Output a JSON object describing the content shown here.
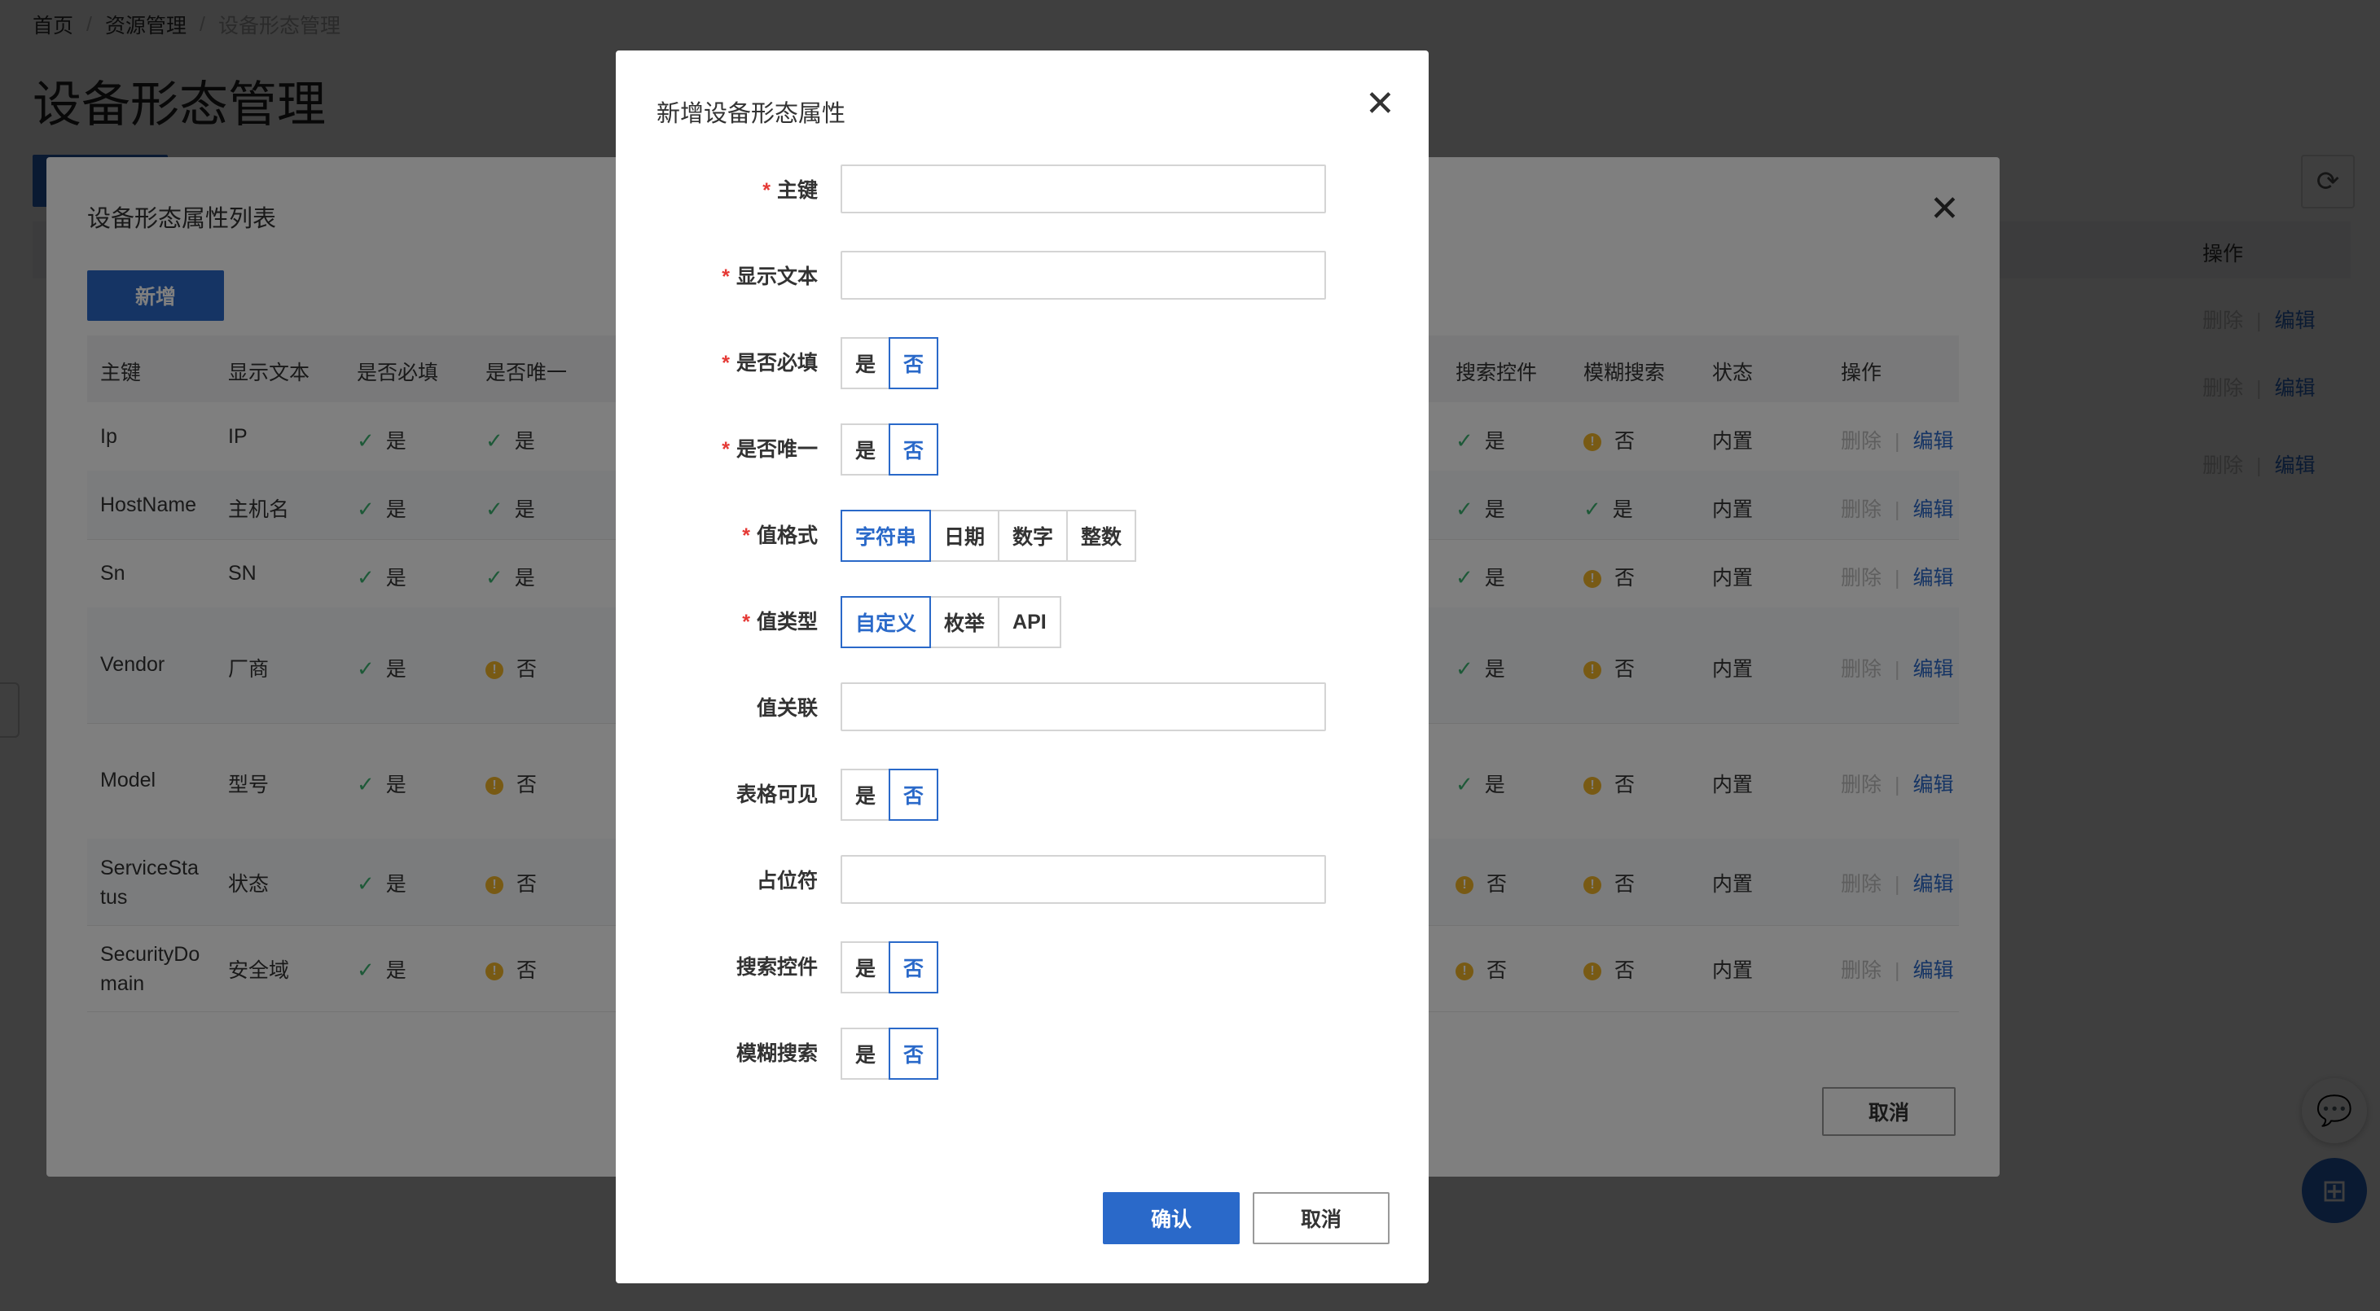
{
  "breadcrumb": [
    "首页",
    "资源管理",
    "设备形态管理"
  ],
  "page": {
    "title": "设备形态管理",
    "table_op_header": "操作",
    "row_ops": [
      {
        "delete": "删除",
        "edit": "编辑"
      },
      {
        "delete": "删除",
        "edit": "编辑"
      },
      {
        "delete": "删除",
        "edit": "编辑"
      }
    ]
  },
  "list_modal": {
    "title": "设备形态属性列表",
    "add_label": "新增",
    "cancel_label": "取消",
    "columns": [
      "主键",
      "显示文本",
      "是否必填",
      "是否唯一",
      "搜索控件",
      "模糊搜索",
      "状态",
      "操作"
    ],
    "rows": [
      {
        "key": "Ip",
        "text": "IP",
        "required": "是",
        "unique": "是",
        "search": "是",
        "fuzzy": "否",
        "status": "内置",
        "del": "删除",
        "edit": "编辑"
      },
      {
        "key": "HostName",
        "text": "主机名",
        "required": "是",
        "unique": "是",
        "search": "是",
        "fuzzy": "是",
        "status": "内置",
        "del": "删除",
        "edit": "编辑"
      },
      {
        "key": "Sn",
        "text": "SN",
        "required": "是",
        "unique": "是",
        "search": "是",
        "fuzzy": "否",
        "status": "内置",
        "del": "删除",
        "edit": "编辑"
      },
      {
        "key": "Vendor",
        "text": "厂商",
        "required": "是",
        "unique": "否",
        "search": "是",
        "fuzzy": "否",
        "status": "内置",
        "del": "删除",
        "edit": "编辑"
      },
      {
        "key": "Model",
        "text": "型号",
        "required": "是",
        "unique": "否",
        "search": "是",
        "fuzzy": "否",
        "status": "内置",
        "del": "删除",
        "edit": "编辑"
      },
      {
        "key1": "ServiceSta",
        "key2": "tus",
        "text": "状态",
        "required": "是",
        "unique": "否",
        "search": "否",
        "fuzzy": "否",
        "status": "内置",
        "del": "删除",
        "edit": "编辑"
      },
      {
        "key1": "SecurityDo",
        "key2": "main",
        "text": "安全域",
        "required": "是",
        "unique": "否",
        "search": "否",
        "fuzzy": "否",
        "status": "内置",
        "del": "删除",
        "edit": "编辑"
      }
    ]
  },
  "form_modal": {
    "title": "新增设备形态属性",
    "fields": {
      "key": {
        "label": "主键",
        "value": ""
      },
      "display_text": {
        "label": "显示文本",
        "value": ""
      },
      "required": {
        "label": "是否必填",
        "options": [
          "是",
          "否"
        ],
        "selected": "否"
      },
      "unique": {
        "label": "是否唯一",
        "options": [
          "是",
          "否"
        ],
        "selected": "否"
      },
      "value_format": {
        "label": "值格式",
        "options": [
          "字符串",
          "日期",
          "数字",
          "整数"
        ],
        "selected": "字符串"
      },
      "value_type": {
        "label": "值类型",
        "options": [
          "自定义",
          "枚举",
          "API"
        ],
        "selected": "自定义"
      },
      "value_link": {
        "label": "值关联",
        "value": ""
      },
      "table_visible": {
        "label": "表格可见",
        "options": [
          "是",
          "否"
        ],
        "selected": "否"
      },
      "placeholder": {
        "label": "占位符",
        "value": ""
      },
      "search_control": {
        "label": "搜索控件",
        "options": [
          "是",
          "否"
        ],
        "selected": "否"
      },
      "fuzzy_search": {
        "label": "模糊搜索",
        "options": [
          "是",
          "否"
        ],
        "selected": "否"
      }
    },
    "confirm_label": "确认",
    "cancel_label": "取消"
  },
  "colors": {
    "primary": "#2a69c9",
    "success": "#3cb371",
    "warning": "#f0b429",
    "required": "#e53935"
  }
}
